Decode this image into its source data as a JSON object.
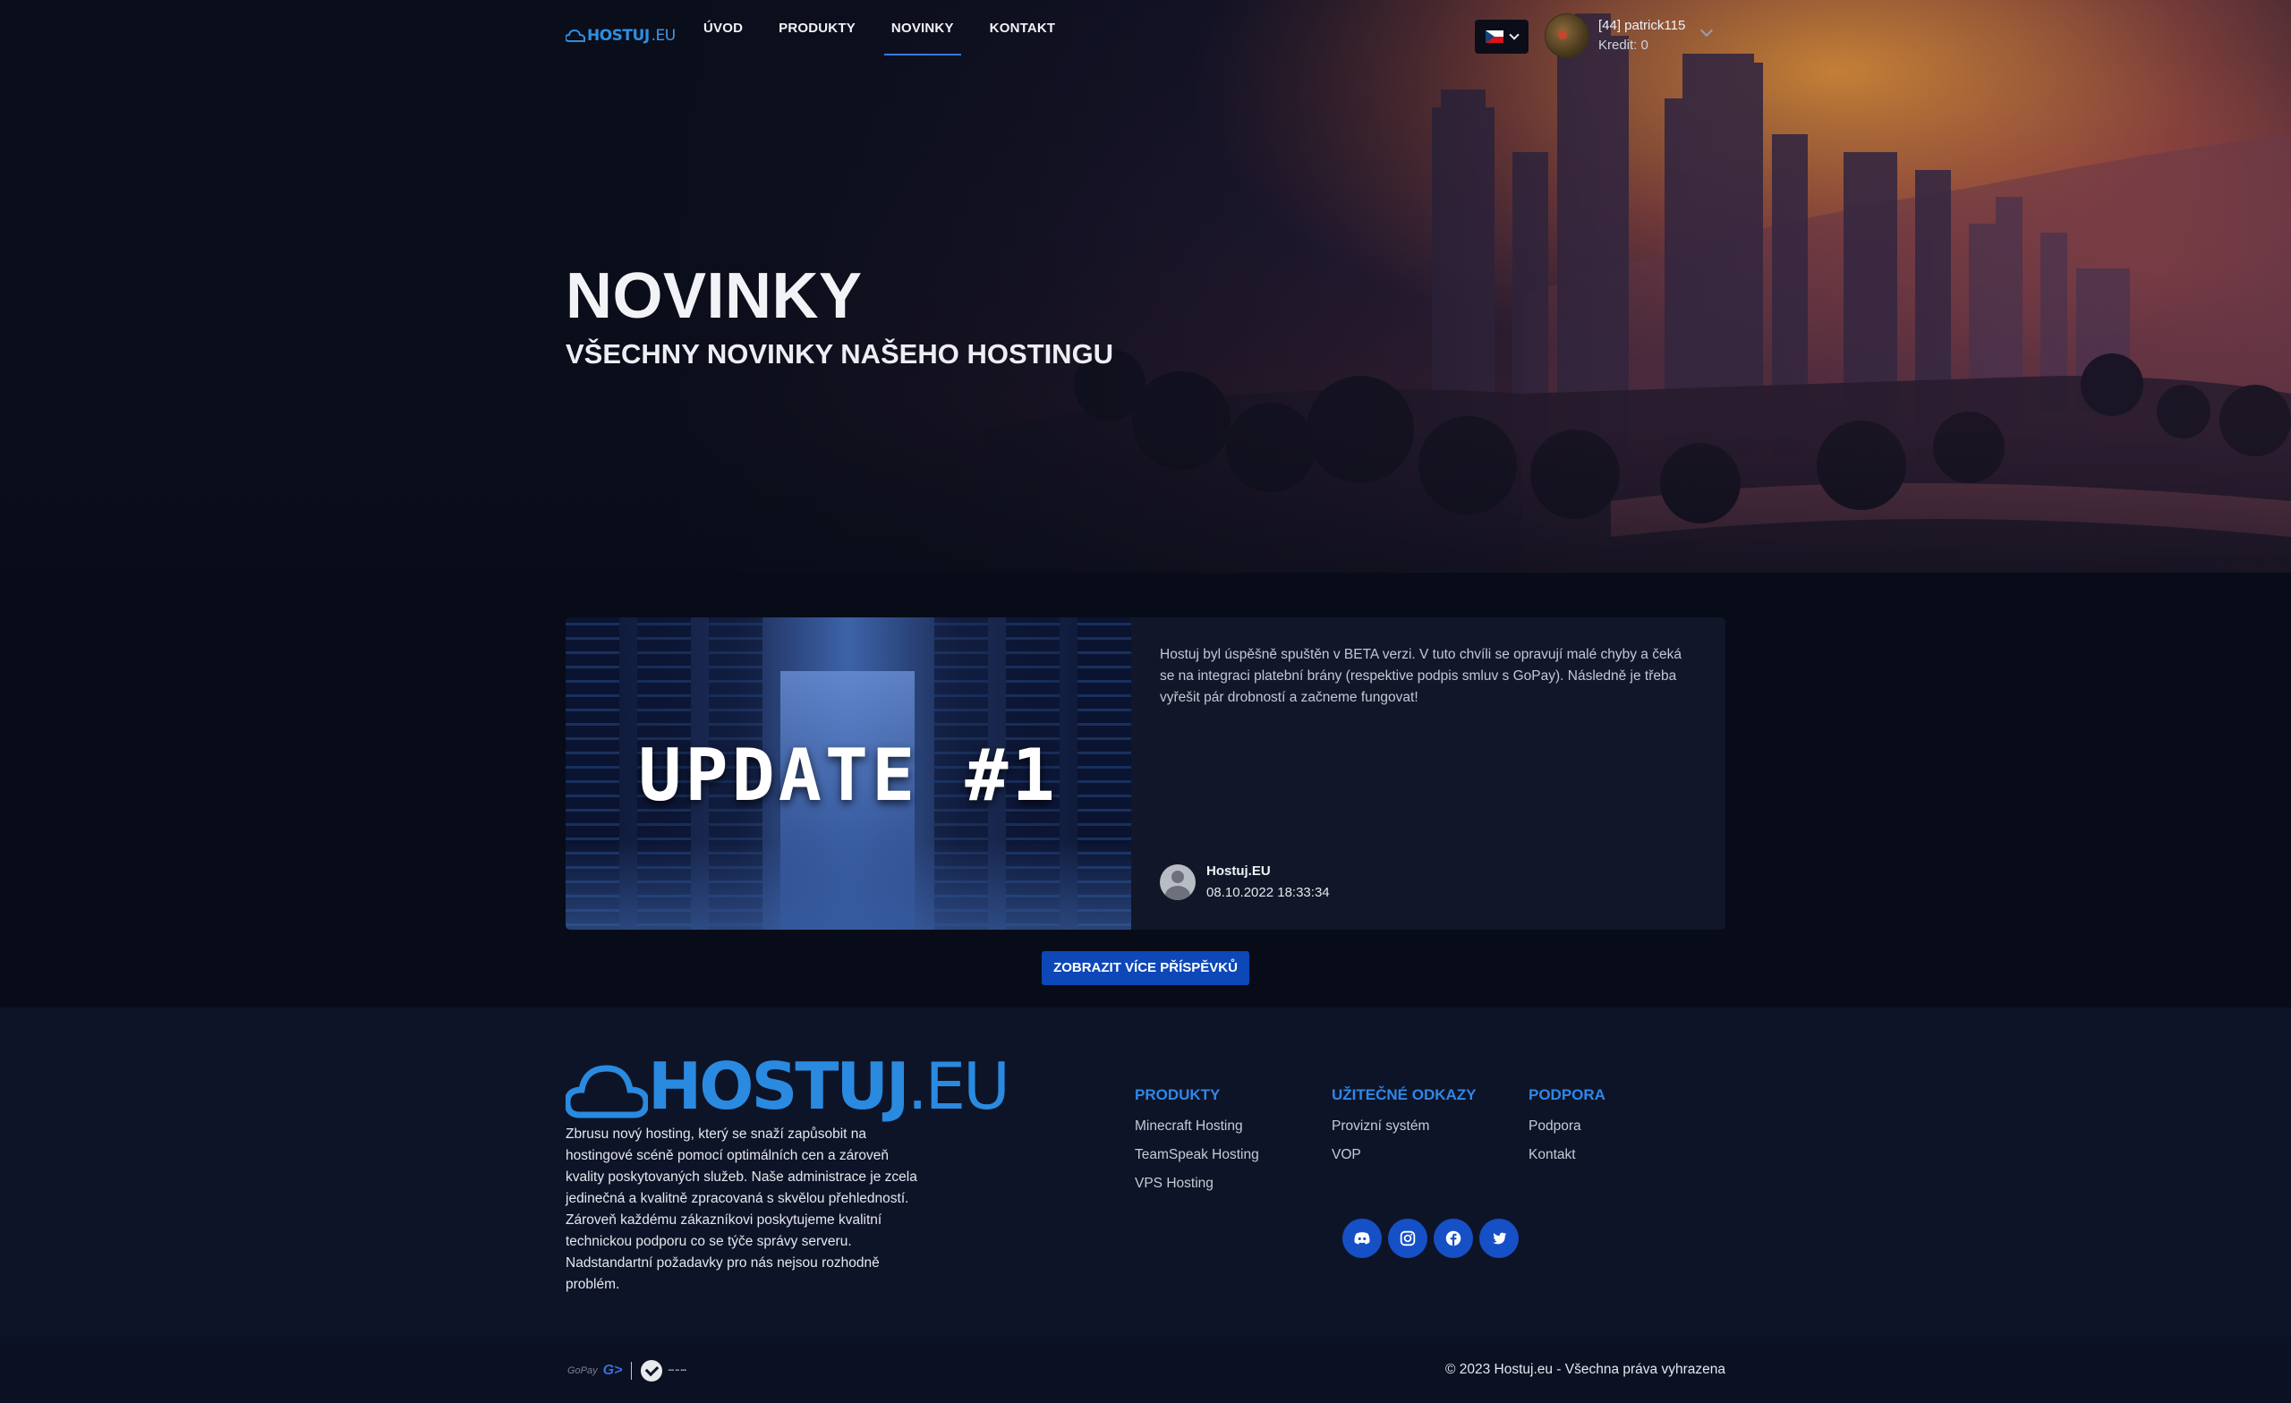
{
  "brand": {
    "name_bold": "HOSTUJ",
    "name_thin": ".EU"
  },
  "nav": {
    "items": [
      {
        "label": "ÚVOD",
        "active": false
      },
      {
        "label": "PRODUKTY",
        "active": false
      },
      {
        "label": "NOVINKY",
        "active": true
      },
      {
        "label": "KONTAKT",
        "active": false
      }
    ],
    "language": "cs"
  },
  "user": {
    "name": "[44] patrick115",
    "credit": "Kredit: 0"
  },
  "hero": {
    "title": "NOVINKY",
    "subtitle": "VŠECHNY NOVINKY NAŠEHO HOSTINGU"
  },
  "post": {
    "image_text": "UPDATE #1",
    "body": "Hostuj byl úspěšně spuštěn v BETA verzi. V tuto chvíli se opravují malé chyby a čeká se na integraci platební brány (respektive podpis smluv s GoPay). Následně je třeba vyřešit pár drobností a začneme fungovat!",
    "author": "Hostuj.EU",
    "date": "08.10.2022 18:33:34"
  },
  "more_button": "ZOBRAZIT VÍCE PŘÍSPĚVKŮ",
  "footer": {
    "about": "Zbrusu nový hosting, který se snaží zapůsobit na hostingové scéně pomocí optimálních cen a zároveň kvality poskytovaných služeb. Naše administrace je zcela jedinečná a kvalitně zpracovaná s skvělou přehledností. Zároveň každému zákazníkovi poskytujeme kvalitní technickou podporu co se týče správy serveru. Nadstandartní požadavky pro nás nejsou rozhodně problém.",
    "columns": [
      {
        "title": "PRODUKTY",
        "links": [
          "Minecraft Hosting",
          "TeamSpeak Hosting",
          "VPS Hosting"
        ]
      },
      {
        "title": "UŽITEČNÉ ODKAZY",
        "links": [
          "Provizní systém",
          "VOP"
        ]
      },
      {
        "title": "PODPORA",
        "links": [
          "Podpora",
          "Kontakt"
        ]
      }
    ],
    "socials": [
      "discord-icon",
      "instagram-icon",
      "facebook-icon",
      "twitter-icon"
    ],
    "payment": {
      "gopay": "GoPay",
      "gopay_mark": "G>"
    },
    "copyright": "© 2023 Hostuj.eu - Všechna práva vyhrazena"
  },
  "colors": {
    "accent": "#2f87e8",
    "button": "#0d47b8",
    "background": "#080c18",
    "footer": "#0e1427"
  }
}
